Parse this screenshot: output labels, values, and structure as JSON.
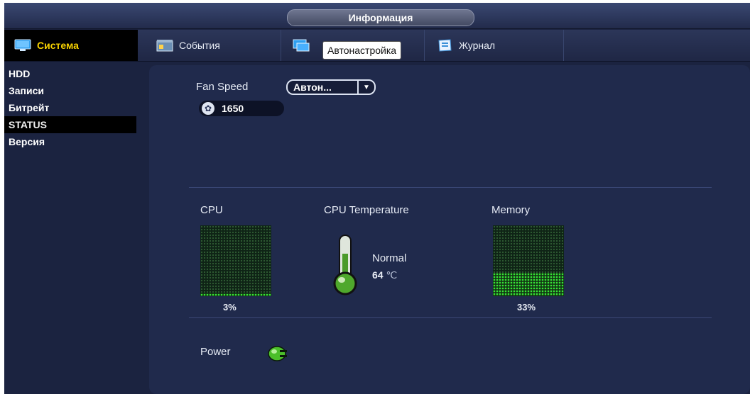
{
  "window": {
    "title": "Информация"
  },
  "tabs": [
    {
      "label": "Система",
      "active": true,
      "icon": "system-icon"
    },
    {
      "label": "События",
      "active": false,
      "icon": "events-icon"
    },
    {
      "label": "",
      "active": false,
      "icon": "autoconfig-icon"
    },
    {
      "label": "Журнал",
      "active": false,
      "icon": "log-icon"
    }
  ],
  "tooltip": "Автонастройка",
  "sidebar": {
    "items": [
      {
        "label": "HDD",
        "active": false
      },
      {
        "label": "Записи",
        "active": false
      },
      {
        "label": "Битрейт",
        "active": false
      },
      {
        "label": "STATUS",
        "active": true
      },
      {
        "label": "Версия",
        "active": false
      }
    ]
  },
  "fan": {
    "label": "Fan Speed",
    "mode": "Автон...",
    "speed": "1650",
    "icon": "fan-icon"
  },
  "cpu": {
    "label": "CPU",
    "usage_text": "3%",
    "usage_fraction": 0.03
  },
  "cpu_temp": {
    "label": "CPU Temperature",
    "status": "Normal",
    "value": "64",
    "unit": "℃",
    "icon": "thermometer-icon"
  },
  "memory": {
    "label": "Memory",
    "usage_text": "33%",
    "usage_fraction": 0.33
  },
  "power": {
    "label": "Power",
    "icon": "power-plug-icon"
  },
  "colors": {
    "accent_active_tab": "#f7d200",
    "meter_green": "#37e337",
    "panel_bg": "#202a4c"
  }
}
